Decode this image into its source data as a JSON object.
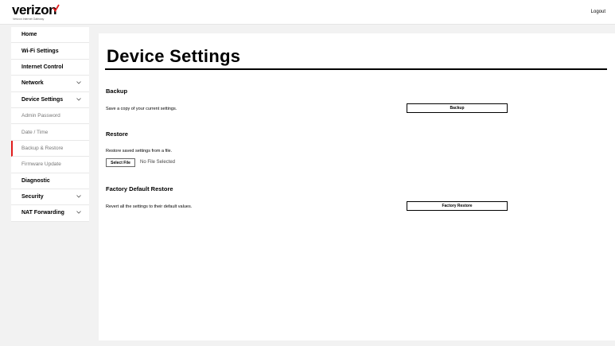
{
  "header": {
    "brand": "verizon",
    "brand_tag": "Verizon Internet Gateway",
    "logout": "Logout",
    "brand_color": "#e11d1d"
  },
  "sidebar": {
    "items": [
      {
        "label": "Home"
      },
      {
        "label": "Wi-Fi Settings"
      },
      {
        "label": "Internet Control"
      },
      {
        "label": "Network"
      },
      {
        "label": "Device Settings"
      },
      {
        "label": "Admin Password"
      },
      {
        "label": "Date / Time"
      },
      {
        "label": "Backup & Restore"
      },
      {
        "label": "Firmware Update"
      },
      {
        "label": "Diagnostic"
      },
      {
        "label": "Security"
      },
      {
        "label": "NAT Forwarding"
      }
    ]
  },
  "main": {
    "title": "Device Settings",
    "backup": {
      "heading": "Backup",
      "text": "Save a copy of your current settings.",
      "button": "Backup"
    },
    "restore": {
      "heading": "Restore",
      "text": "Restore saved settings from a file.",
      "select_button": "Select File",
      "file_status": "No File Selected"
    },
    "factory": {
      "heading": "Factory Default Restore",
      "text": "Revert all the settings to their default values.",
      "button": "Factory Restore"
    }
  }
}
